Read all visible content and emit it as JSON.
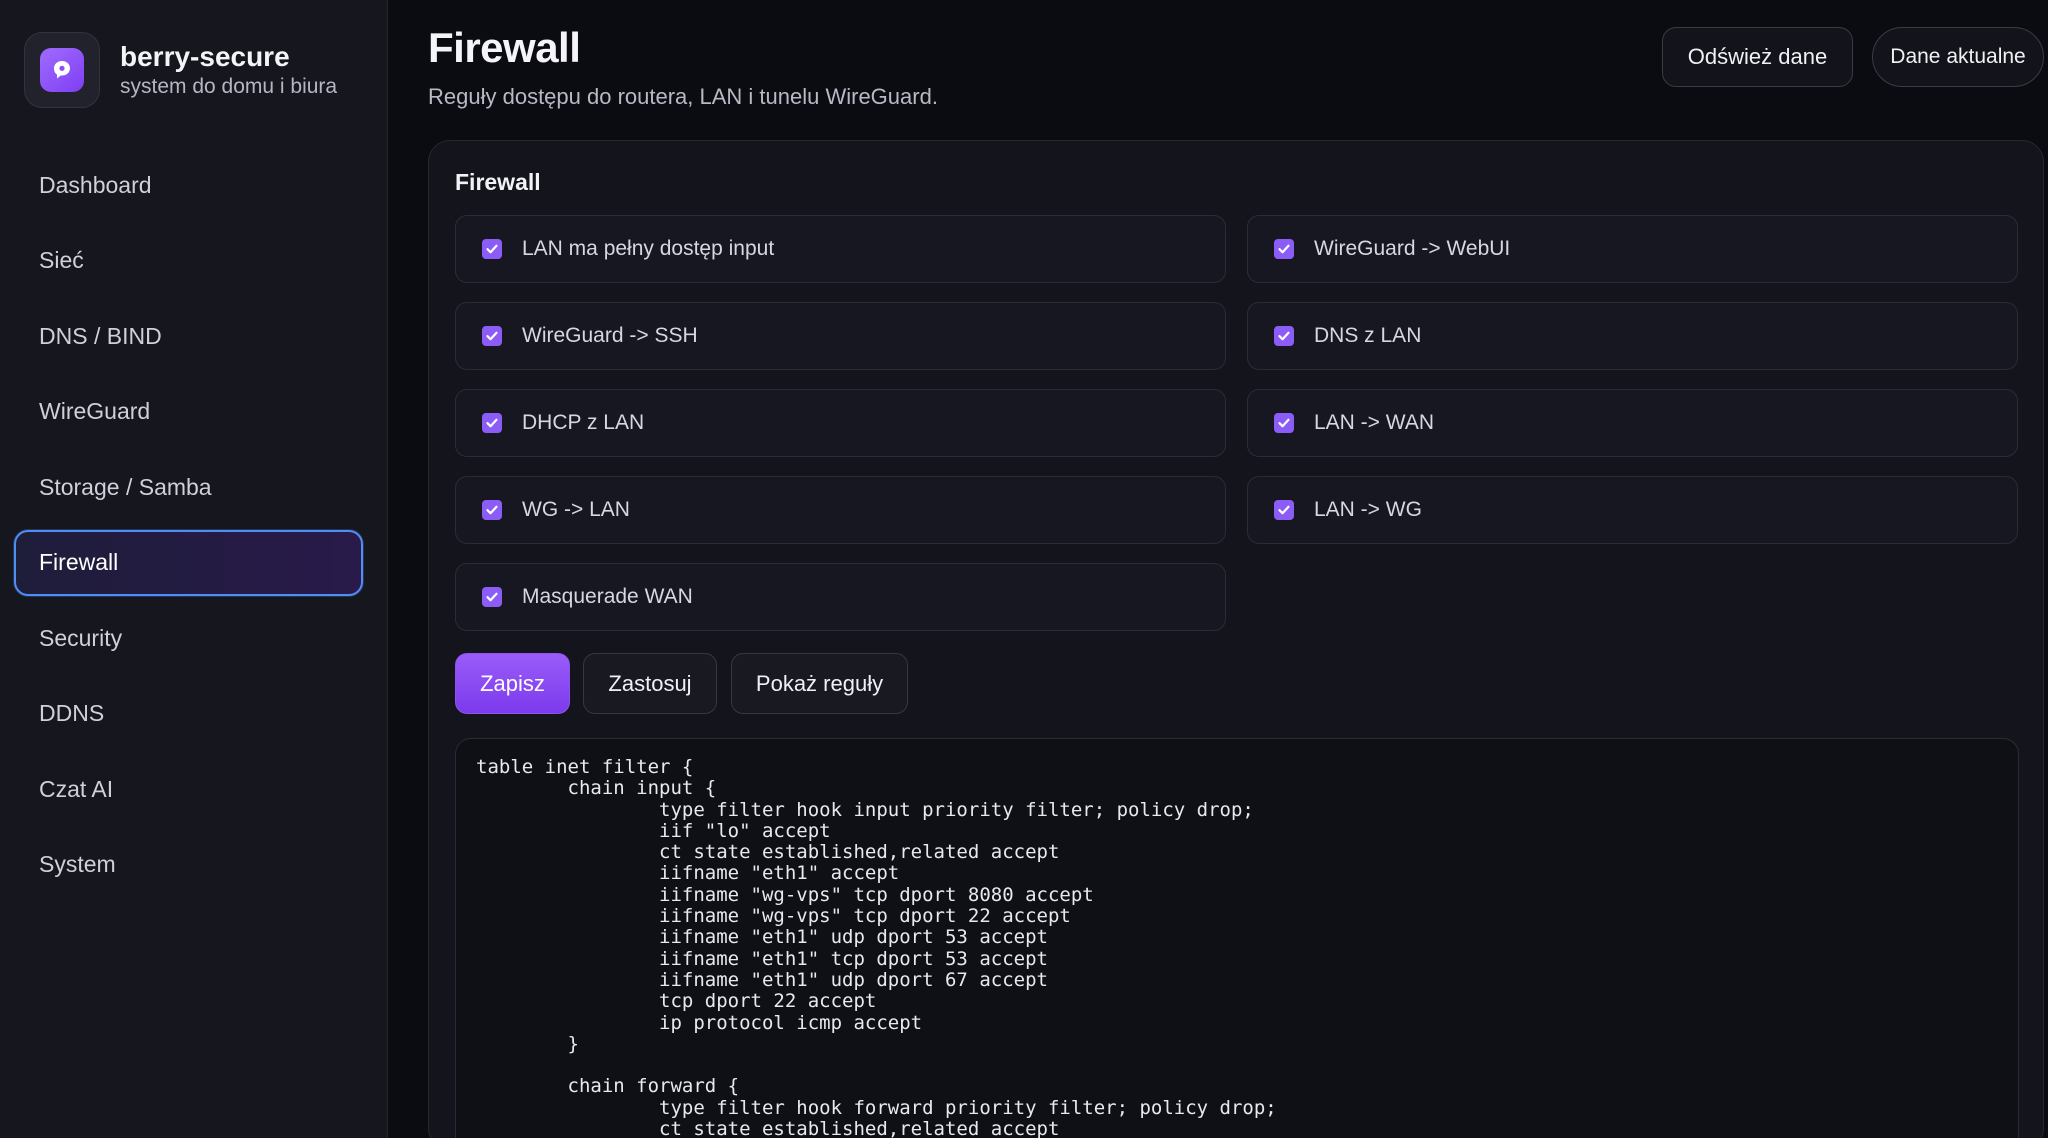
{
  "brand": {
    "name": "berry-secure",
    "subtitle": "system do domu i biura"
  },
  "sidebar": {
    "items": [
      {
        "label": "Dashboard"
      },
      {
        "label": "Sieć"
      },
      {
        "label": "DNS / BIND"
      },
      {
        "label": "WireGuard"
      },
      {
        "label": "Storage / Samba"
      },
      {
        "label": "Firewall",
        "active": true
      },
      {
        "label": "Security"
      },
      {
        "label": "DDNS"
      },
      {
        "label": "Czat AI"
      },
      {
        "label": "System"
      }
    ]
  },
  "header": {
    "title": "Firewall",
    "subtitle": "Reguły dostępu do routera, LAN i tunelu WireGuard.",
    "refresh_label": "Odśwież dane",
    "status_label": "Dane aktualne"
  },
  "card": {
    "title": "Firewall",
    "options": [
      {
        "label": "LAN ma pełny dostęp input",
        "checked": true
      },
      {
        "label": "WireGuard -> WebUI",
        "checked": true
      },
      {
        "label": "WireGuard -> SSH",
        "checked": true
      },
      {
        "label": "DNS z LAN",
        "checked": true
      },
      {
        "label": "DHCP z LAN",
        "checked": true
      },
      {
        "label": "LAN -> WAN",
        "checked": true
      },
      {
        "label": "WG -> LAN",
        "checked": true
      },
      {
        "label": "LAN -> WG",
        "checked": true
      },
      {
        "label": "Masquerade WAN",
        "checked": true
      }
    ],
    "actions": {
      "save": "Zapisz",
      "apply": "Zastosuj",
      "show_rules": "Pokaż reguły"
    },
    "rules_output": "table inet filter {\n        chain input {\n                type filter hook input priority filter; policy drop;\n                iif \"lo\" accept\n                ct state established,related accept\n                iifname \"eth1\" accept\n                iifname \"wg-vps\" tcp dport 8080 accept\n                iifname \"wg-vps\" tcp dport 22 accept\n                iifname \"eth1\" udp dport 53 accept\n                iifname \"eth1\" tcp dport 53 accept\n                iifname \"eth1\" udp dport 67 accept\n                tcp dport 22 accept\n                ip protocol icmp accept\n        }\n\n        chain forward {\n                type filter hook forward priority filter; policy drop;\n                ct state established,related accept"
  },
  "colors": {
    "accent": "#8b5cf6",
    "active_border": "#4f8ef7",
    "background": "#0b0c12",
    "sidebar": "#15161e"
  }
}
